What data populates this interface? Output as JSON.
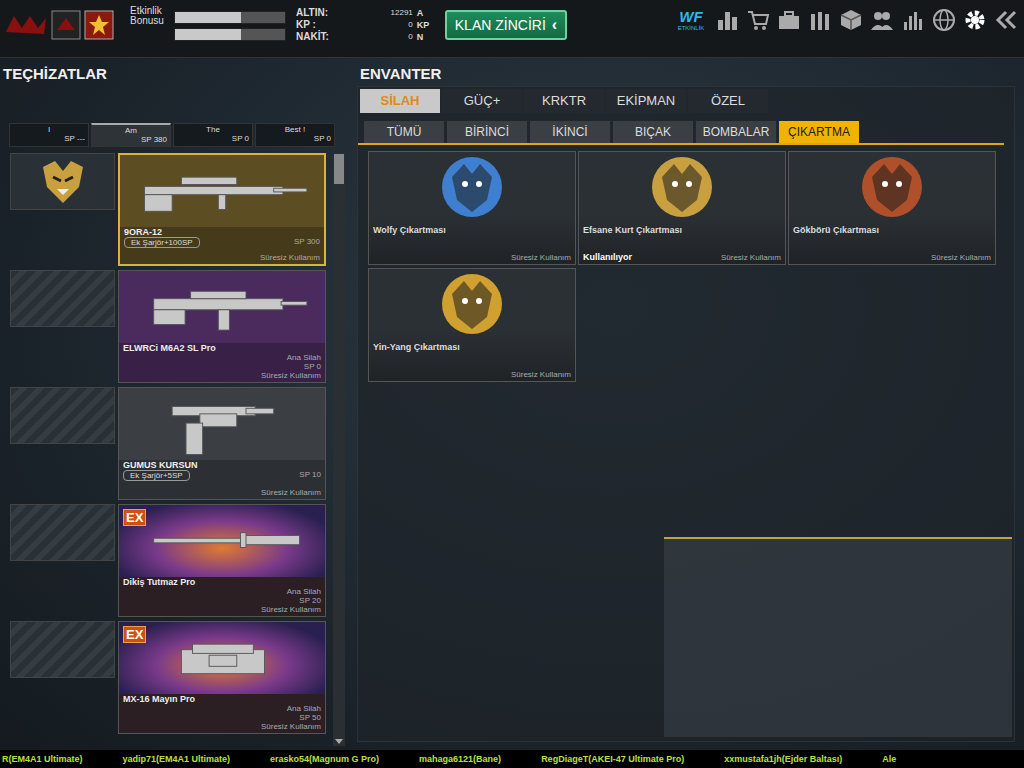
{
  "topbar": {
    "bonus": {
      "label": "Etkinlik Bonusu",
      "bars": [
        {
          "level": 0.6
        },
        {
          "level": 0.6
        }
      ]
    },
    "currencies": [
      {
        "label": "ALTIN:",
        "value": "12291",
        "unit": "A"
      },
      {
        "label": "KP :",
        "value": "0",
        "unit": "KP"
      },
      {
        "label": "NAKİT:",
        "value": "0",
        "unit": "N"
      }
    ],
    "clan_button": "KLAN ZİNCİRİ",
    "clan_arrow": "‹",
    "event_logo": "WF",
    "event_label": "ETKİNLİK"
  },
  "equipment": {
    "title": "TEÇHİZATLAR",
    "loadouts": [
      {
        "name": "I",
        "sp": "SP ---",
        "selected": false
      },
      {
        "name": "Am",
        "sp": "SP 380",
        "selected": true
      },
      {
        "name": "The",
        "sp": "SP 0",
        "selected": false
      },
      {
        "name": "Best !",
        "sp": "SP 0",
        "selected": false
      }
    ],
    "slots": [
      {
        "filled": true,
        "card": {
          "name": "9ORA-12",
          "kind": "attachment",
          "subtitle": "Ek Şarjör+100SP",
          "sp": "SP 300",
          "duration": "Süresiz Kullanım",
          "badge": null,
          "selected": true,
          "color": "#5c4e22"
        }
      },
      {
        "filled": false,
        "card": {
          "name": "ELWRCi M6A2 SL Pro",
          "kind": "weapon",
          "subtitle": "Ana Silah",
          "sp": "SP 0",
          "duration": "Süresiz Kullanım",
          "badge": null,
          "selected": false,
          "color": "#4b2b5e"
        }
      },
      {
        "filled": false,
        "card": {
          "name": "GUMUS KURSUN",
          "kind": "attachment",
          "subtitle": "Ek Şarjör+5SP",
          "sp": "SP 10",
          "duration": "Süresiz Kullanım",
          "badge": null,
          "selected": false,
          "color": "#3b3f44"
        }
      },
      {
        "filled": false,
        "card": {
          "name": "Dikiş Tutmaz Pro",
          "kind": "weapon",
          "subtitle": "Ana Silah",
          "sp": "SP 20",
          "duration": "Süresiz Kullanım",
          "badge": "EX",
          "selected": false,
          "color": "#3a2a30"
        }
      },
      {
        "filled": false,
        "card": {
          "name": "MX-16 Mayın Pro",
          "kind": "weapon",
          "subtitle": "Ana Silah",
          "sp": "SP 50",
          "duration": "Süresiz Kullanım",
          "badge": "EX",
          "selected": false,
          "color": "#3a2a30"
        }
      }
    ]
  },
  "inventory": {
    "title": "ENVANTER",
    "tabs": [
      {
        "label": "SİLAH",
        "selected": true
      },
      {
        "label": "GÜÇ+",
        "selected": false
      },
      {
        "label": "KRKTR",
        "selected": false
      },
      {
        "label": "EKİPMAN",
        "selected": false
      },
      {
        "label": "ÖZEL",
        "selected": false
      }
    ],
    "subtabs": [
      {
        "label": "TÜMÜ",
        "selected": false
      },
      {
        "label": "BİRİNCİ",
        "selected": false
      },
      {
        "label": "İKİNCİ",
        "selected": false
      },
      {
        "label": "BIÇAK",
        "selected": false
      },
      {
        "label": "BOMBALAR",
        "selected": false
      },
      {
        "label": "ÇIKARTMA",
        "selected": true
      }
    ],
    "items": [
      {
        "name": "Wolfy Çıkartması",
        "duration": "Süresiz Kullanım",
        "in_use": false,
        "status": "",
        "color": "#3f7fd0"
      },
      {
        "name": "Efsane Kurt Çıkartması",
        "duration": "Süresiz Kullanım",
        "in_use": true,
        "status": "Kullanılıyor",
        "color": "#c9a040"
      },
      {
        "name": "Gökbörü Çıkartması",
        "duration": "Süresiz Kullanım",
        "in_use": false,
        "status": "",
        "color": "#b0502a"
      },
      {
        "name": "Yin-Yang Çıkartması",
        "duration": "Süresiz Kullanım",
        "in_use": false,
        "status": "",
        "color": "#d0a030"
      }
    ]
  },
  "ticker": [
    "R(EM4A1 Ultimate)",
    "yadip71(EM4A1 Ultimate)",
    "erasko54(Magnum G Pro)",
    "mahaga6121(Bane)",
    "RegDiageT(AKEI-47 Ultimate Pro)",
    "xxmustafa1jh(Ejder Baltası)",
    "Ale"
  ]
}
